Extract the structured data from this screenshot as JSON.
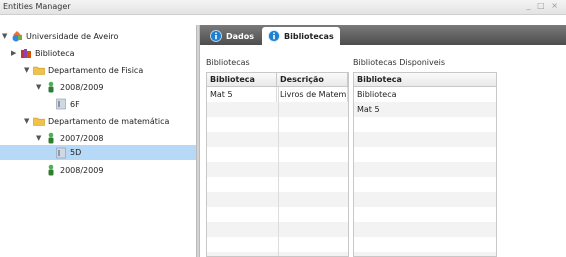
{
  "window": {
    "title": "Entities Manager",
    "controls": "_ □ ×"
  },
  "tree": {
    "items": [
      {
        "label": "Universidade de Aveiro",
        "arrow": "▼",
        "icon": "university-icon"
      },
      {
        "label": "Biblioteca",
        "arrow": "▶",
        "icon": "books-icon"
      },
      {
        "label": "Departamento de Fisica",
        "arrow": "▼",
        "icon": "folder-icon"
      },
      {
        "label": "2008/2009",
        "arrow": "▼",
        "icon": "person-icon"
      },
      {
        "label": "6F",
        "arrow": "",
        "icon": "class-icon"
      },
      {
        "label": "Departamento de matemática",
        "arrow": "▼",
        "icon": "folder-icon"
      },
      {
        "label": "2007/2008",
        "arrow": "▼",
        "icon": "person-icon"
      },
      {
        "label": "5D",
        "arrow": "",
        "icon": "class-icon",
        "selected": true
      },
      {
        "label": "2008/2009",
        "arrow": "",
        "icon": "person-icon"
      }
    ]
  },
  "tabs": [
    {
      "label": "Dados",
      "icon": "info-icon",
      "active": false
    },
    {
      "label": "Bibliotecas",
      "icon": "info-icon",
      "active": true
    }
  ],
  "bibliotecas": {
    "section_label": "Bibliotecas",
    "headers": [
      "Biblioteca",
      "Descrição"
    ],
    "rows": [
      [
        "Mat 5",
        "Livros de Matem"
      ]
    ]
  },
  "disponiveis": {
    "section_label": "Bibliotecas Disponiveis",
    "headers": [
      "Biblioteca"
    ],
    "rows": [
      [
        "Biblioteca"
      ],
      [
        "Mat 5"
      ]
    ]
  },
  "colors": {
    "selection": "#b6d9f7",
    "tabbar": "#5a5a5a",
    "accent_blue": "#1f7fd0"
  }
}
